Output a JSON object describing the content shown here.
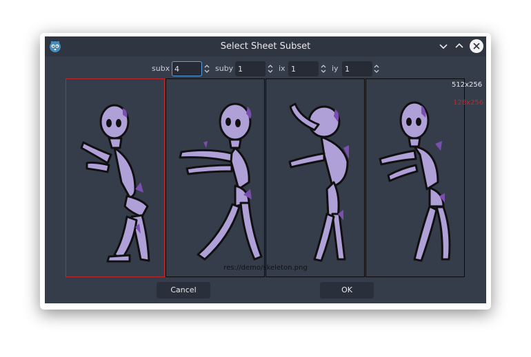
{
  "window": {
    "title": "Select Sheet Subset",
    "app_icon": "godot-icon",
    "controls_icons": [
      "chevron-down-icon",
      "chevron-up-icon",
      "close-icon"
    ]
  },
  "subset": {
    "subx_label": "subx",
    "subx_value": "4",
    "suby_label": "suby",
    "suby_value": "1",
    "ix_label": "ix",
    "ix_value": "1",
    "iy_label": "iy",
    "iy_value": "1"
  },
  "sheet": {
    "image_size": "512x256",
    "frame_size": "128x256",
    "path": "res://demo/skeleton.png",
    "frame_count": 4,
    "selected_frame": 1
  },
  "buttons": {
    "cancel": "Cancel",
    "ok": "OK"
  },
  "colors": {
    "bg": "#363d4a",
    "titlebar": "#2f3541",
    "selection": "#c0262c",
    "focus": "#5aa0e6",
    "bone": "#b0a0d8",
    "bone_shade": "#7a4fb0"
  }
}
